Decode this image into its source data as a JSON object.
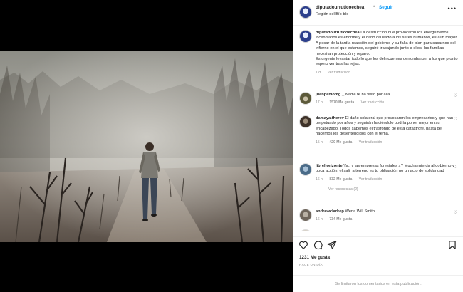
{
  "post": {
    "username": "diputadourruticoechea",
    "separator": "•",
    "follow_label": "Seguir",
    "location": "Región del Bío-bío",
    "more_label": "•••"
  },
  "caption": {
    "username": "diputadourruticoechea",
    "paragraph_1": "La destruccion que provocaron los energúmenos incendiarios es enorme y el daño causado a los seres humanos, es aún mayor.",
    "paragraph_2": "A pesar de la tardía reacción del gobierno y su falta de plan para sacarnos del infierno en el que estamos, seguiré trabajando junto a ellos, las familias necesitan protección y reparo.",
    "paragraph_3": "Es urgente levantar todo lo que los delincuentes derrumbaron, a los que pronto espero ver tras las rejas.",
    "time": "1 d",
    "translation_label": "Ver traducción"
  },
  "comments": [
    {
      "username": "juanpablomg._",
      "text": "Nadie te ha visto por allá.",
      "time": "17 h",
      "likes": "1570 Me gusta",
      "translation_label": "Ver traducción"
    },
    {
      "username": "damaya.therev",
      "text": "El daño colateral que provocaron los empresarios y que han perpetuado por años y seguirán haciéndolo podría poner mejor en su encabezado. Todos sabemos el trasfondo de esta catástrofe, basta de hacernos los desentendidos con el tema.",
      "time": "15 h",
      "likes": "420 Me gusta",
      "translation_label": "Ver traducción"
    },
    {
      "username": "librehorizonte",
      "text": "Ya.. y las empresas forestales ¿? Mucha mierda al gobierno y poca acción, el salir a terreno es tu obligación no un acto de solidaridad",
      "time": "16 h",
      "likes": "832 Me gusta",
      "translation_label": "Ver traducción",
      "replies_label": "Ver respuestas (2)"
    },
    {
      "username": "andrewclarkep",
      "text": "Wena Will Smith",
      "time": "16 h",
      "likes": "734 Me gusta"
    }
  ],
  "footer": {
    "likes": "1231 Me gusta",
    "ago": "HACE UN DÍA",
    "comments_limited": "Se limitaron los comentarios en esta publicación."
  },
  "icons": [
    "heart-icon",
    "comment-icon",
    "share-icon",
    "bookmark-icon",
    "more-icon"
  ],
  "colors": {
    "accent": "#0095f6",
    "muted": "#8e8e8e",
    "text": "#262626"
  }
}
